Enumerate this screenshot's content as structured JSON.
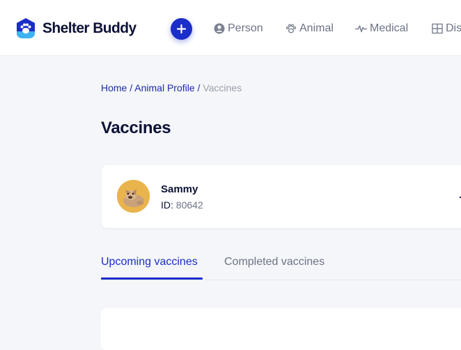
{
  "app": {
    "brand_name": "Shelter Buddy",
    "brand_color": "#1b2ec9"
  },
  "nav": {
    "items": [
      {
        "label": "Person",
        "icon": "person-circle-icon"
      },
      {
        "label": "Animal",
        "icon": "paw-icon"
      },
      {
        "label": "Medical",
        "icon": "pulse-icon"
      },
      {
        "label": "Dis",
        "icon": "grid-icon"
      }
    ],
    "add_icon": "plus-icon"
  },
  "breadcrumb": {
    "home": "Home",
    "sep1": "/",
    "profile": "Animal Profile",
    "sep2": "/",
    "current": "Vaccines"
  },
  "page": {
    "title": "Vaccines"
  },
  "profile": {
    "name": "Sammy",
    "id_label": "ID:",
    "id_value": "80642"
  },
  "tabs": {
    "active": "Upcoming vaccines",
    "inactive": "Completed vaccines"
  }
}
